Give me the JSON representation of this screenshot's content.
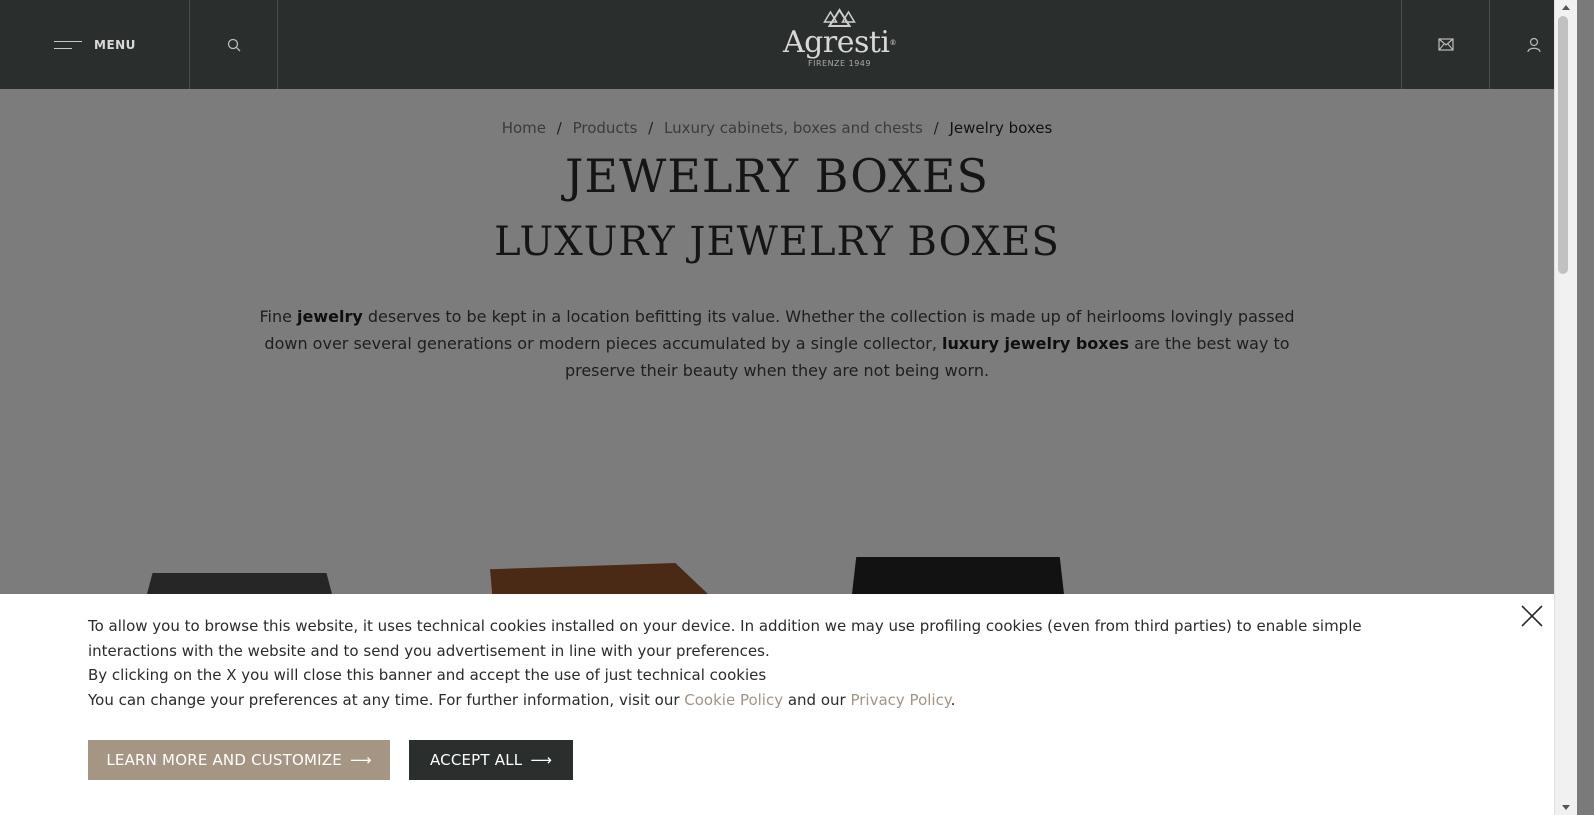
{
  "header": {
    "menu_label": "MENU",
    "logo_text": "Agresti",
    "logo_reg": "®",
    "logo_sub": "FIRENZE 1949"
  },
  "breadcrumb": {
    "items": [
      "Home",
      "Products",
      "Luxury cabinets, boxes and chests"
    ],
    "current": "Jewelry boxes",
    "separator": "/"
  },
  "page": {
    "title": "JEWELRY BOXES",
    "subtitle": "LUXURY JEWELRY BOXES",
    "intro": {
      "p1": "Fine ",
      "b1": "jewelry",
      "p2": " deserves to be kept in a location befitting its value. Whether the collection is made up of heirlooms lovingly passed down over several generations or modern pieces accumulated by a single collector, ",
      "b2": "luxury jewelry boxes",
      "p3": " are the best way to preserve their beauty when they are not being worn."
    }
  },
  "cookie": {
    "line1": "To allow you to browse this website, it uses technical cookies installed on your device. In addition we may use profiling cookies (even from third parties) to enable simple interactions with the website and to send you advertisement in line with your preferences.",
    "line2": "By clicking on the X you will close this banner and accept the use of just technical cookies",
    "line3_pre": "You can change your preferences at any time. For further information, visit our ",
    "cookie_policy": "Cookie Policy",
    "line3_mid": " and our ",
    "privacy_policy": "Privacy Policy",
    "line3_end": ".",
    "learn_more_label": "LEARN MORE AND CUSTOMIZE",
    "accept_label": "ACCEPT ALL",
    "arrow": "⟶"
  },
  "colors": {
    "header_bg": "#2a2e2d",
    "overlay": "#7c7c7c",
    "accent_beige": "#a49683",
    "link_beige": "#a49483"
  }
}
